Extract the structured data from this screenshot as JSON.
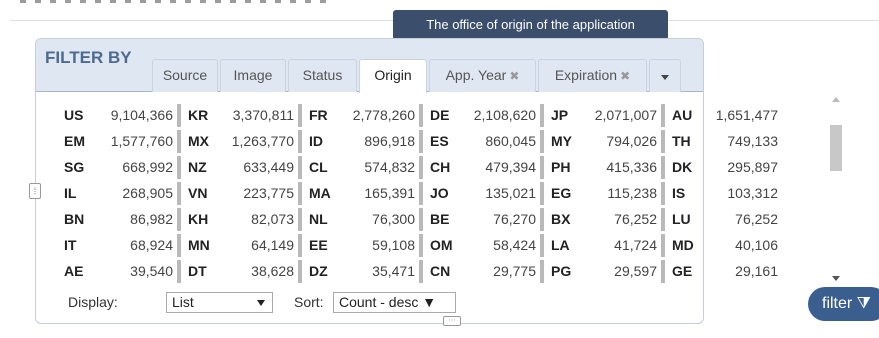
{
  "tooltip": "The office of origin of the application",
  "filter": {
    "title": "FILTER BY",
    "tabs": [
      {
        "label": "Source",
        "removable": false
      },
      {
        "label": "Image",
        "removable": false
      },
      {
        "label": "Status",
        "removable": false
      },
      {
        "label": "Origin",
        "removable": false,
        "active": true
      },
      {
        "label": "App. Year",
        "removable": true
      },
      {
        "label": "Expiration",
        "removable": true
      }
    ],
    "remove_glyph": "✖"
  },
  "counts": [
    [
      {
        "code": "US",
        "count": "9,104,366"
      },
      {
        "code": "KR",
        "count": "3,370,811"
      },
      {
        "code": "FR",
        "count": "2,778,260"
      },
      {
        "code": "DE",
        "count": "2,108,620"
      },
      {
        "code": "JP",
        "count": "2,071,007"
      },
      {
        "code": "AU",
        "count": "1,651,477"
      }
    ],
    [
      {
        "code": "EM",
        "count": "1,577,760"
      },
      {
        "code": "MX",
        "count": "1,263,770"
      },
      {
        "code": "ID",
        "count": "896,918"
      },
      {
        "code": "ES",
        "count": "860,045"
      },
      {
        "code": "MY",
        "count": "794,026"
      },
      {
        "code": "TH",
        "count": "749,133"
      }
    ],
    [
      {
        "code": "SG",
        "count": "668,992"
      },
      {
        "code": "NZ",
        "count": "633,449"
      },
      {
        "code": "CL",
        "count": "574,832"
      },
      {
        "code": "CH",
        "count": "479,394"
      },
      {
        "code": "PH",
        "count": "415,336"
      },
      {
        "code": "DK",
        "count": "295,897"
      }
    ],
    [
      {
        "code": "IL",
        "count": "268,905"
      },
      {
        "code": "VN",
        "count": "223,775"
      },
      {
        "code": "MA",
        "count": "165,391"
      },
      {
        "code": "JO",
        "count": "135,021"
      },
      {
        "code": "EG",
        "count": "115,238"
      },
      {
        "code": "IS",
        "count": "103,312"
      }
    ],
    [
      {
        "code": "BN",
        "count": "86,982"
      },
      {
        "code": "KH",
        "count": "82,073"
      },
      {
        "code": "NL",
        "count": "76,300"
      },
      {
        "code": "BE",
        "count": "76,270"
      },
      {
        "code": "BX",
        "count": "76,252"
      },
      {
        "code": "LU",
        "count": "76,252"
      }
    ],
    [
      {
        "code": "IT",
        "count": "68,924"
      },
      {
        "code": "MN",
        "count": "64,149"
      },
      {
        "code": "EE",
        "count": "59,108"
      },
      {
        "code": "OM",
        "count": "58,424"
      },
      {
        "code": "LA",
        "count": "41,724"
      },
      {
        "code": "MD",
        "count": "40,106"
      }
    ],
    [
      {
        "code": "AE",
        "count": "39,540"
      },
      {
        "code": "DT",
        "count": "38,628"
      },
      {
        "code": "DZ",
        "count": "35,471"
      },
      {
        "code": "CN",
        "count": "29,775"
      },
      {
        "code": "PG",
        "count": "29,597"
      },
      {
        "code": "GE",
        "count": "29,161"
      }
    ]
  ],
  "controls": {
    "display_label": "Display:",
    "display_value": "List",
    "sort_label": "Sort:",
    "sort_value": "Count - desc ▼"
  },
  "filter_button": "filter ⧩",
  "colors": {
    "accent": "#3a5f8f",
    "header_bg": "#dfe7f2",
    "tooltip_bg": "#3b4e6b",
    "title": "#4d6a91"
  }
}
